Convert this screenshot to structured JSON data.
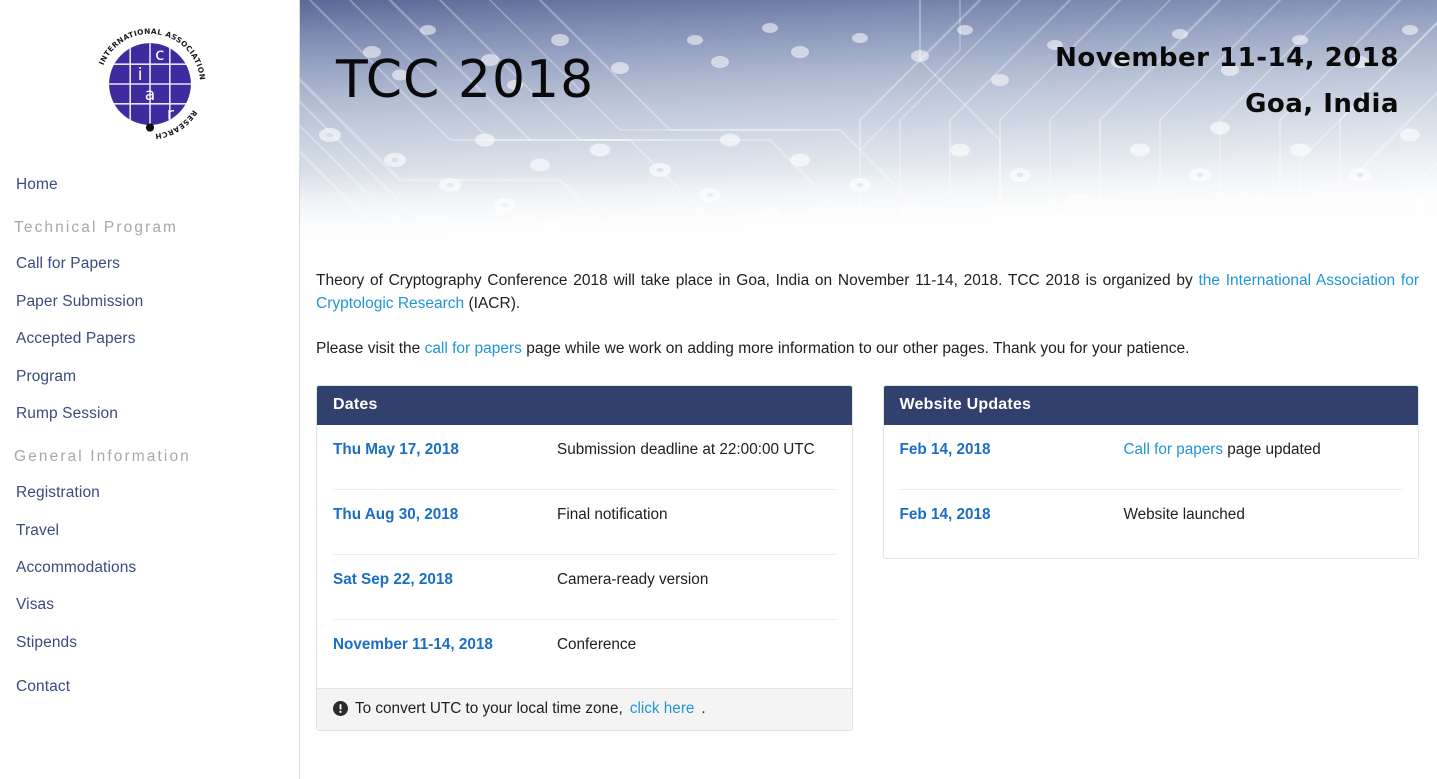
{
  "logo": {
    "alt": "iacr-logo",
    "ring_text": "INTERNATIONAL ASSOCIATION FOR CRYPTOLOGIC RESEARCH",
    "letters": [
      "i",
      "a",
      "c",
      "r"
    ],
    "color": "#3f2aa0"
  },
  "sidebar": {
    "items": [
      {
        "type": "link",
        "label": "Home",
        "name": "sidebar-item-home"
      },
      {
        "type": "heading",
        "label": "Technical Program",
        "name": "sidebar-heading-technical-program"
      },
      {
        "type": "link",
        "label": "Call for Papers",
        "name": "sidebar-item-call-for-papers"
      },
      {
        "type": "link",
        "label": "Paper Submission",
        "name": "sidebar-item-paper-submission"
      },
      {
        "type": "link",
        "label": "Accepted Papers",
        "name": "sidebar-item-accepted-papers"
      },
      {
        "type": "link",
        "label": "Program",
        "name": "sidebar-item-program"
      },
      {
        "type": "link",
        "label": "Rump Session",
        "name": "sidebar-item-rump-session"
      },
      {
        "type": "heading",
        "label": "General Information",
        "name": "sidebar-heading-general-information"
      },
      {
        "type": "link",
        "label": "Registration",
        "name": "sidebar-item-registration"
      },
      {
        "type": "link",
        "label": "Travel",
        "name": "sidebar-item-travel"
      },
      {
        "type": "link",
        "label": "Accommodations",
        "name": "sidebar-item-accommodations"
      },
      {
        "type": "link",
        "label": "Visas",
        "name": "sidebar-item-visas"
      },
      {
        "type": "link",
        "label": "Stipends",
        "name": "sidebar-item-stipends"
      },
      {
        "type": "gap",
        "label": ""
      },
      {
        "type": "link",
        "label": "Contact",
        "name": "sidebar-item-contact"
      }
    ]
  },
  "banner": {
    "title": "TCC 2018",
    "date": "November 11-14, 2018",
    "location": "Goa, India",
    "background": "circuit-board-photo"
  },
  "intro": {
    "p1_a": "Theory of Cryptography Conference 2018 will take place in Goa, India on November 11-14, 2018. TCC 2018 is organized by ",
    "p1_link": "the International Association for Cryptologic Research",
    "p1_b": " (IACR).",
    "p2_a": "Please visit the ",
    "p2_link": "call for papers",
    "p2_b": " page while we work on adding more information to our other pages. Thank you for your patience."
  },
  "dates_panel": {
    "title": "Dates",
    "rows": [
      {
        "date": "Thu May 17, 2018",
        "text": "Submission deadline at 22:00:00 UTC"
      },
      {
        "date": "Thu Aug 30, 2018",
        "text": "Final notification"
      },
      {
        "date": "Sat Sep 22, 2018",
        "text": "Camera-ready version"
      },
      {
        "date": "November 11-14, 2018",
        "text": "Conference"
      }
    ],
    "footer_icon": "info-circle-icon",
    "footer_a": "To convert UTC to your local time zone, ",
    "footer_link": "click here",
    "footer_b": "."
  },
  "updates_panel": {
    "title": "Website Updates",
    "rows": [
      {
        "date": "Feb 14, 2018",
        "link": "Call for papers",
        "text": " page updated"
      },
      {
        "date": "Feb 14, 2018",
        "link": "",
        "text": "Website launched"
      }
    ]
  },
  "colors": {
    "panel_header": "#32406e",
    "link_blue": "#2196d6",
    "date_blue": "#1a6fc4",
    "nav_blue": "#3b4a80",
    "nav_heading_gray": "#a8a8a8",
    "panel_border_green": "#d7ecd7",
    "footer_gray": "#f4f4f4"
  }
}
